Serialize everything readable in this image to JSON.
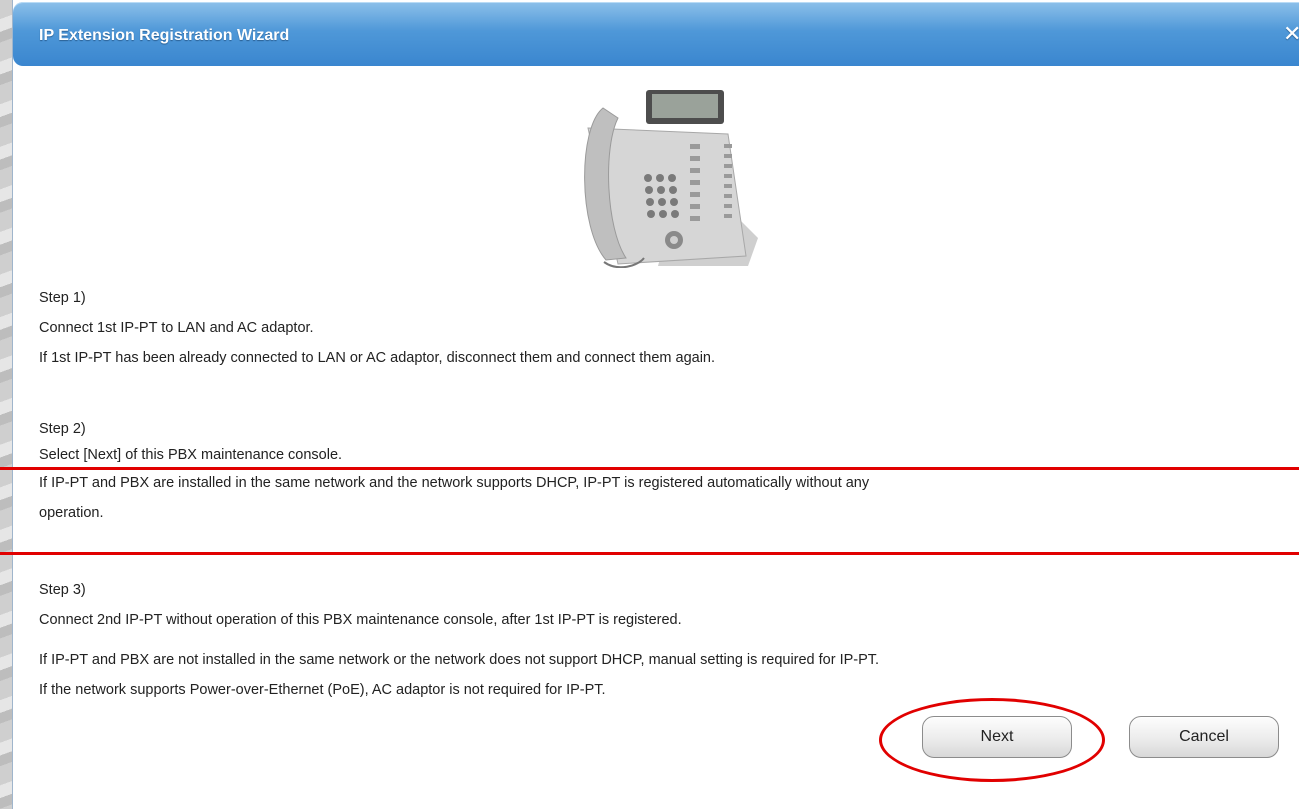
{
  "window": {
    "title": "IP Extension Registration Wizard",
    "close_icon": "close-icon"
  },
  "image": {
    "icon": "ip-phone-image"
  },
  "steps": {
    "step1_heading": "Step 1)",
    "step1_line1": "Connect 1st IP-PT to LAN and AC adaptor.",
    "step1_line2": "If 1st IP-PT has been already connected to LAN or AC adaptor, disconnect them and connect them again.",
    "step2_heading": "Step 2)",
    "step2_line1": "Select [Next] of this PBX maintenance console.",
    "step2_line2": "If IP-PT and PBX are installed in the same network and the network supports DHCP, IP-PT is registered automatically without any",
    "step2_line3": "operation.",
    "step3_heading": "Step 3)",
    "step3_line1": "Connect 2nd IP-PT without operation of this PBX maintenance console, after 1st IP-PT is registered.",
    "note_line1": "If IP-PT and PBX are not installed in the same network or the network does not support DHCP, manual setting is required for IP-PT.",
    "note_line2": "If the network supports Power-over-Ethernet (PoE), AC adaptor is not required for IP-PT."
  },
  "buttons": {
    "next_label": "Next",
    "cancel_label": "Cancel"
  },
  "colors": {
    "titlebar": "#4f98d8",
    "annotation": "#e10000"
  }
}
